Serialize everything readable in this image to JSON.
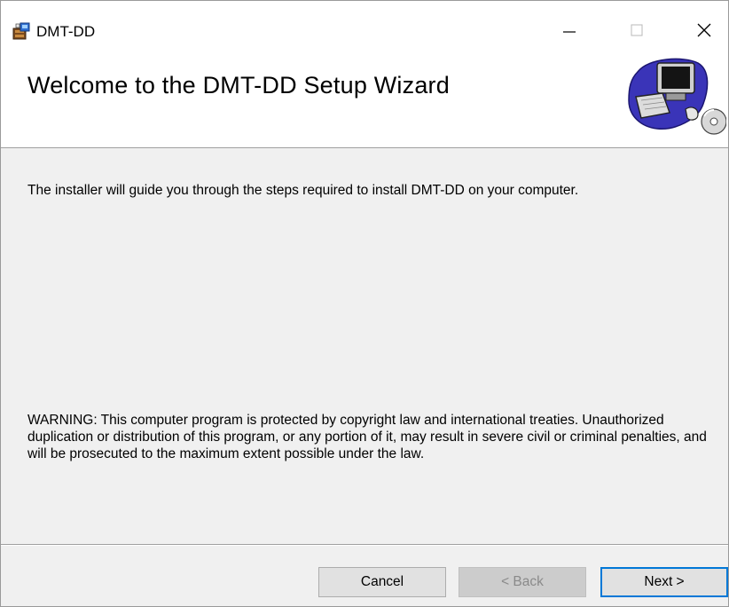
{
  "window": {
    "title": "DMT-DD",
    "icon": "installer-package-icon",
    "controls": [
      "minimize-icon",
      "maximize-icon",
      "close-icon"
    ]
  },
  "banner": {
    "title": "Welcome to the DMT-DD Setup Wizard",
    "art": "computer-setup-icon"
  },
  "content": {
    "intro": "The installer will guide you through the steps required to install DMT-DD on your computer.",
    "warning": "WARNING: This computer program is protected by copyright law and international treaties. Unauthorized duplication or distribution of this program, or any portion of it, may result in severe civil or criminal penalties, and will be prosecuted to the maximum extent possible under the law."
  },
  "buttons": {
    "cancel": "Cancel",
    "back": "< Back",
    "next": "Next >"
  },
  "colors": {
    "accent": "#0078d7",
    "background": "#f0f0f0",
    "banner": "#ffffff"
  }
}
